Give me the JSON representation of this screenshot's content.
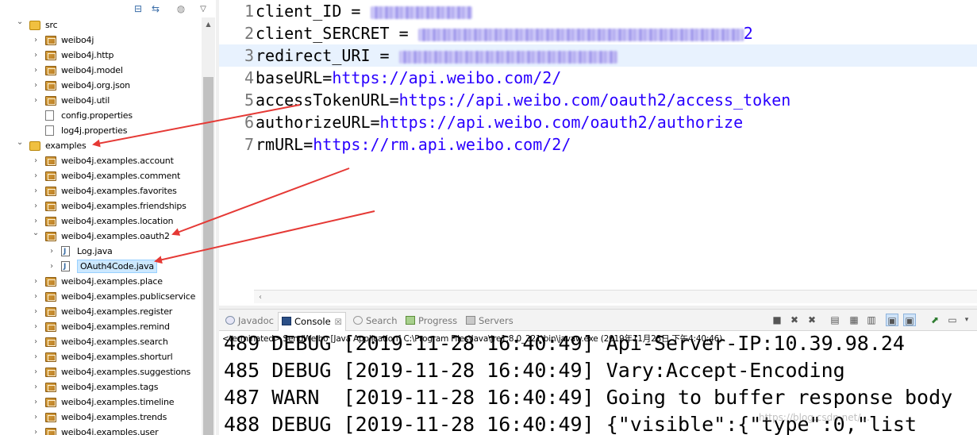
{
  "explorer": {
    "tree": [
      {
        "id": "src",
        "label": "src",
        "level": 0,
        "expanded": true,
        "type": "source-folder"
      },
      {
        "id": "weibo4j",
        "label": "weibo4j",
        "level": 1,
        "expanded": false,
        "type": "package"
      },
      {
        "id": "weibo4j-http",
        "label": "weibo4j.http",
        "level": 1,
        "expanded": false,
        "type": "package"
      },
      {
        "id": "weibo4j-model",
        "label": "weibo4j.model",
        "level": 1,
        "expanded": false,
        "type": "package"
      },
      {
        "id": "weibo4j-org-json",
        "label": "weibo4j.org.json",
        "level": 1,
        "expanded": false,
        "type": "package"
      },
      {
        "id": "weibo4j-util",
        "label": "weibo4j.util",
        "level": 1,
        "expanded": false,
        "type": "package"
      },
      {
        "id": "config-properties",
        "label": "config.properties",
        "level": 1,
        "type": "file"
      },
      {
        "id": "log4j-properties",
        "label": "log4j.properties",
        "level": 1,
        "type": "file"
      },
      {
        "id": "examples",
        "label": "examples",
        "level": 0,
        "expanded": true,
        "type": "source-folder"
      },
      {
        "id": "ex-account",
        "label": "weibo4j.examples.account",
        "level": 1,
        "expanded": false,
        "type": "package"
      },
      {
        "id": "ex-comment",
        "label": "weibo4j.examples.comment",
        "level": 1,
        "expanded": false,
        "type": "package"
      },
      {
        "id": "ex-favorites",
        "label": "weibo4j.examples.favorites",
        "level": 1,
        "expanded": false,
        "type": "package"
      },
      {
        "id": "ex-friendships",
        "label": "weibo4j.examples.friendships",
        "level": 1,
        "expanded": false,
        "type": "package"
      },
      {
        "id": "ex-location",
        "label": "weibo4j.examples.location",
        "level": 1,
        "expanded": false,
        "type": "package"
      },
      {
        "id": "ex-oauth2",
        "label": "weibo4j.examples.oauth2",
        "level": 1,
        "expanded": true,
        "type": "package"
      },
      {
        "id": "log-java",
        "label": "Log.java",
        "level": 2,
        "expanded": false,
        "type": "java"
      },
      {
        "id": "oauth4code-java",
        "label": "OAuth4Code.java",
        "level": 2,
        "expanded": false,
        "type": "java",
        "selected": true
      },
      {
        "id": "ex-place",
        "label": "weibo4j.examples.place",
        "level": 1,
        "expanded": false,
        "type": "package"
      },
      {
        "id": "ex-publicservice",
        "label": "weibo4j.examples.publicservice",
        "level": 1,
        "expanded": false,
        "type": "package"
      },
      {
        "id": "ex-register",
        "label": "weibo4j.examples.register",
        "level": 1,
        "expanded": false,
        "type": "package"
      },
      {
        "id": "ex-remind",
        "label": "weibo4j.examples.remind",
        "level": 1,
        "expanded": false,
        "type": "package"
      },
      {
        "id": "ex-search",
        "label": "weibo4j.examples.search",
        "level": 1,
        "expanded": false,
        "type": "package"
      },
      {
        "id": "ex-shorturl",
        "label": "weibo4j.examples.shorturl",
        "level": 1,
        "expanded": false,
        "type": "package"
      },
      {
        "id": "ex-suggestions",
        "label": "weibo4j.examples.suggestions",
        "level": 1,
        "expanded": false,
        "type": "package"
      },
      {
        "id": "ex-tags",
        "label": "weibo4j.examples.tags",
        "level": 1,
        "expanded": false,
        "type": "package"
      },
      {
        "id": "ex-timeline",
        "label": "weibo4j.examples.timeline",
        "level": 1,
        "expanded": false,
        "type": "package"
      },
      {
        "id": "ex-trends",
        "label": "weibo4j.examples.trends",
        "level": 1,
        "expanded": false,
        "type": "package"
      },
      {
        "id": "ex-user",
        "label": "weibo4j.examples.user",
        "level": 1,
        "expanded": false,
        "type": "package"
      }
    ]
  },
  "editor": {
    "lines": [
      {
        "num": "1",
        "key": "client_ID = ",
        "value": "",
        "redacted": true,
        "current": false
      },
      {
        "num": "2",
        "key": "client_SERCRET = ",
        "value": "",
        "redacted": true,
        "redacted_tail": "2",
        "current": false
      },
      {
        "num": "3",
        "key": "redirect_URI = ",
        "value": "",
        "redacted": true,
        "current": true
      },
      {
        "num": "4",
        "key": "baseURL=",
        "value": "https://api.weibo.com/2/",
        "redacted": false,
        "current": false
      },
      {
        "num": "5",
        "key": "accessTokenURL=",
        "value": "https://api.weibo.com/oauth2/access_token",
        "redacted": false,
        "current": false
      },
      {
        "num": "6",
        "key": "authorizeURL=",
        "value": "https://api.weibo.com/oauth2/authorize",
        "redacted": false,
        "current": false
      },
      {
        "num": "7",
        "key": "rmURL=",
        "value": "https://rm.api.weibo.com/2/",
        "redacted": false,
        "current": false
      }
    ]
  },
  "console": {
    "tabs": [
      {
        "id": "javadoc",
        "label": "Javadoc",
        "active": false
      },
      {
        "id": "console",
        "label": "Console",
        "active": true,
        "close": "☒"
      },
      {
        "id": "search",
        "label": "Search",
        "active": false
      },
      {
        "id": "progress",
        "label": "Progress",
        "active": false
      },
      {
        "id": "servers",
        "label": "Servers",
        "active": false
      }
    ],
    "status": "<terminated> SendWeibo [Java Application] C:\\Program Files\\Java\\jre1.8.0_221\\bin\\javaw.exe (2019年11月28日 下午4:40:46)",
    "log": [
      {
        "num": "489",
        "level": "DEBUG",
        "time": "[2019-11-28 16:40:49]",
        "msg": "Api-Server-IP:10.39.98.24"
      },
      {
        "num": "485",
        "level": "DEBUG",
        "time": "[2019-11-28 16:40:49]",
        "msg": "Vary:Accept-Encoding"
      },
      {
        "num": "487",
        "level": "WARN ",
        "time": "[2019-11-28 16:40:49]",
        "msg": "Going to buffer response body"
      },
      {
        "num": "488",
        "level": "DEBUG",
        "time": "[2019-11-28 16:40:49]",
        "msg": "{\"visible\":{\"type\":0,\"list"
      }
    ],
    "watermark": "https://blog.csdn.net/..."
  }
}
